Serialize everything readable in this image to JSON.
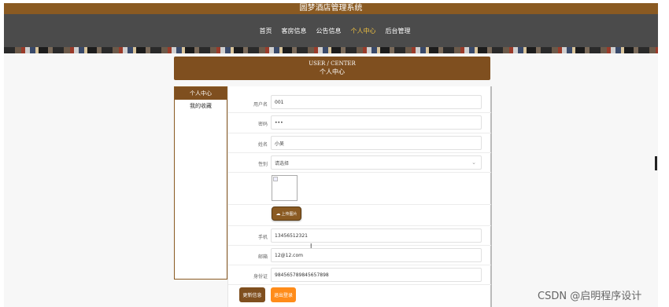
{
  "app": {
    "title": "圆梦酒店管理系统"
  },
  "nav": {
    "items": [
      {
        "label": "首页",
        "active": false
      },
      {
        "label": "客房信息",
        "active": false
      },
      {
        "label": "公告信息",
        "active": false
      },
      {
        "label": "个人中心",
        "active": true
      },
      {
        "label": "后台管理",
        "active": false
      }
    ]
  },
  "header": {
    "en": "USER / CENTER",
    "cn": "个人中心"
  },
  "sidebar": {
    "items": [
      {
        "label": "个人中心",
        "active": true
      },
      {
        "label": "我的收藏",
        "active": false
      }
    ]
  },
  "form": {
    "username": {
      "label": "用户名",
      "value": "001"
    },
    "password": {
      "label": "密码",
      "value": "•••"
    },
    "name": {
      "label": "姓名",
      "value": "小吴"
    },
    "gender": {
      "label": "性别",
      "value": "请选择"
    },
    "upload_label": "上传图片",
    "phone": {
      "label": "手机",
      "value": "13456512321"
    },
    "email": {
      "label": "邮箱",
      "value": "12@12.com"
    },
    "idcard": {
      "label": "身份证",
      "value": "984565789845657898"
    }
  },
  "buttons": {
    "update": "更新信息",
    "logout": "退出登录"
  },
  "watermark": "CSDN @启明程序设计",
  "colors": {
    "brand": "#7f4f1f",
    "nav_bg": "#4b4b4b",
    "nav_active": "#f0c040",
    "logout": "#ff8c1a"
  }
}
